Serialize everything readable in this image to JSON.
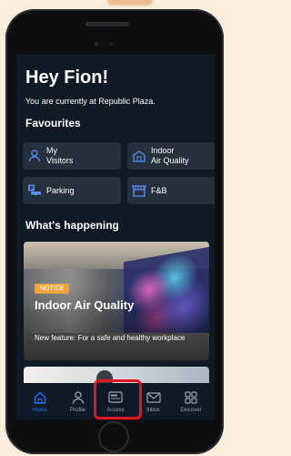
{
  "greeting": "Hey Fion!",
  "location_text": "You are currently at Republic Plaza.",
  "favourites": {
    "title": "Favourites",
    "items": [
      {
        "label": "My\nVisitors",
        "icon": "visitor-icon"
      },
      {
        "label": "Indoor\nAir Quality",
        "icon": "building-air-icon"
      },
      {
        "label": "Parking",
        "icon": "parking-icon"
      },
      {
        "label": "F&B",
        "icon": "storefront-icon"
      }
    ]
  },
  "happening": {
    "title": "What's happening",
    "card": {
      "badge": "NOTICE",
      "title": "Indoor Air Quality",
      "description": "New feature: For a safe and healthy workplace"
    }
  },
  "tabs": [
    {
      "label": "Home",
      "icon": "home-icon",
      "active": true
    },
    {
      "label": "Profile",
      "icon": "profile-icon",
      "active": false
    },
    {
      "label": "Access",
      "icon": "access-card-icon",
      "active": false
    },
    {
      "label": "Inbox",
      "icon": "inbox-icon",
      "active": false
    },
    {
      "label": "Discover",
      "icon": "discover-grid-icon",
      "active": false
    }
  ],
  "colors": {
    "screen_background": "#0f1a26",
    "tile_background": "#26303d",
    "accent": "#2f6df6",
    "notice_badge": "#f0a542",
    "highlight": "#e3161f",
    "page_background": "#fbeedd"
  }
}
